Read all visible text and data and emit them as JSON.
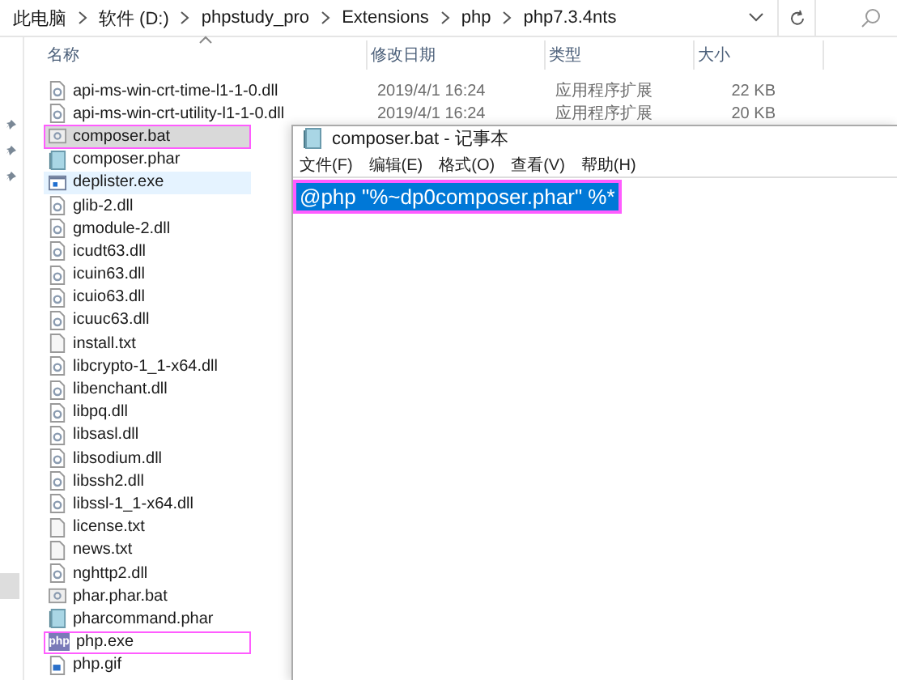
{
  "address_bar": {
    "segments": [
      "此电脑",
      "软件 (D:)",
      "phpstudy_pro",
      "Extensions",
      "php",
      "php7.3.4nts"
    ]
  },
  "columns": [
    "名称",
    "修改日期",
    "类型",
    "大小"
  ],
  "files": [
    {
      "name": "api-ms-win-crt-time-l1-1-0.dll",
      "kind": "dll",
      "date": "2019/4/1 16:24",
      "type": "应用程序扩展",
      "size": "22 KB",
      "selected": false,
      "hovered": false,
      "annotated": false
    },
    {
      "name": "api-ms-win-crt-utility-l1-1-0.dll",
      "kind": "dll",
      "date": "2019/4/1 16:24",
      "type": "应用程序扩展",
      "size": "20 KB",
      "selected": false,
      "hovered": false,
      "annotated": false
    },
    {
      "name": "composer.bat",
      "kind": "bat",
      "selected": true,
      "hovered": false,
      "annotated": true
    },
    {
      "name": "composer.phar",
      "kind": "phar",
      "selected": false,
      "hovered": false,
      "annotated": false
    },
    {
      "name": "deplister.exe",
      "kind": "exe",
      "selected": false,
      "hovered": true,
      "annotated": false
    },
    {
      "name": "glib-2.dll",
      "kind": "dll",
      "selected": false,
      "hovered": false,
      "annotated": false
    },
    {
      "name": "gmodule-2.dll",
      "kind": "dll",
      "selected": false,
      "hovered": false,
      "annotated": false
    },
    {
      "name": "icudt63.dll",
      "kind": "dll",
      "selected": false,
      "hovered": false,
      "annotated": false
    },
    {
      "name": "icuin63.dll",
      "kind": "dll",
      "selected": false,
      "hovered": false,
      "annotated": false
    },
    {
      "name": "icuio63.dll",
      "kind": "dll",
      "selected": false,
      "hovered": false,
      "annotated": false
    },
    {
      "name": "icuuc63.dll",
      "kind": "dll",
      "selected": false,
      "hovered": false,
      "annotated": false
    },
    {
      "name": "install.txt",
      "kind": "txt",
      "selected": false,
      "hovered": false,
      "annotated": false
    },
    {
      "name": "libcrypto-1_1-x64.dll",
      "kind": "dll",
      "selected": false,
      "hovered": false,
      "annotated": false
    },
    {
      "name": "libenchant.dll",
      "kind": "dll",
      "selected": false,
      "hovered": false,
      "annotated": false
    },
    {
      "name": "libpq.dll",
      "kind": "dll",
      "selected": false,
      "hovered": false,
      "annotated": false
    },
    {
      "name": "libsasl.dll",
      "kind": "dll",
      "selected": false,
      "hovered": false,
      "annotated": false
    },
    {
      "name": "libsodium.dll",
      "kind": "dll",
      "selected": false,
      "hovered": false,
      "annotated": false
    },
    {
      "name": "libssh2.dll",
      "kind": "dll",
      "selected": false,
      "hovered": false,
      "annotated": false
    },
    {
      "name": "libssl-1_1-x64.dll",
      "kind": "dll",
      "selected": false,
      "hovered": false,
      "annotated": false
    },
    {
      "name": "license.txt",
      "kind": "txt",
      "selected": false,
      "hovered": false,
      "annotated": false
    },
    {
      "name": "news.txt",
      "kind": "txt",
      "selected": false,
      "hovered": false,
      "annotated": false
    },
    {
      "name": "nghttp2.dll",
      "kind": "dll",
      "selected": false,
      "hovered": false,
      "annotated": false
    },
    {
      "name": "phar.phar.bat",
      "kind": "bat",
      "selected": false,
      "hovered": false,
      "annotated": false
    },
    {
      "name": "pharcommand.phar",
      "kind": "phar",
      "selected": false,
      "hovered": false,
      "annotated": false
    },
    {
      "name": "php.exe",
      "kind": "phpexe",
      "icon_text": "php",
      "selected": false,
      "hovered": false,
      "annotated": true
    },
    {
      "name": "php.gif",
      "kind": "gif",
      "selected": false,
      "hovered": false,
      "annotated": false
    }
  ],
  "notepad": {
    "title": "composer.bat - 记事本",
    "menu": [
      "文件(F)",
      "编辑(E)",
      "格式(O)",
      "查看(V)",
      "帮助(H)"
    ],
    "content": "@php \"%~dp0composer.phar\" %*",
    "content_selected": true,
    "content_annotated": true
  }
}
